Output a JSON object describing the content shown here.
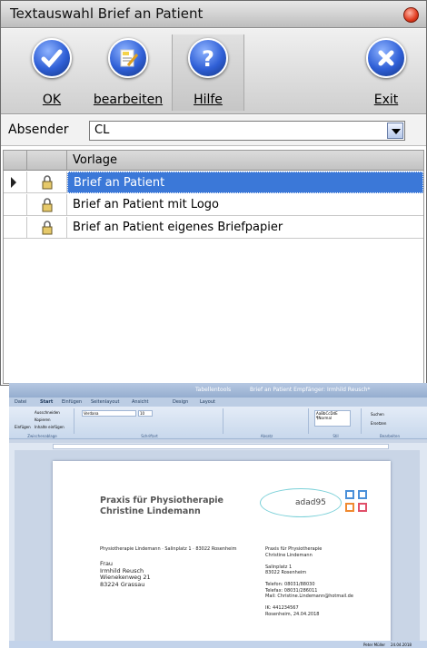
{
  "dialog": {
    "title": "Textauswahl Brief an Patient",
    "toolbar": {
      "ok": "OK",
      "edit": "bearbeiten",
      "help": "Hilfe",
      "exit": "Exit"
    },
    "sender_label": "Absender",
    "sender_value": "CL",
    "grid": {
      "header": "Vorlage",
      "rows": [
        "Brief an Patient",
        "Brief an Patient mit Logo",
        "Brief an Patient eigenes Briefpapier"
      ],
      "selected_index": 0
    }
  },
  "word": {
    "title": "Brief an Patient Empfänger: Irmhild Reusch*",
    "contextual_tab": "Tabellentools",
    "tabs": [
      "Datei",
      "Start",
      "Einfügen",
      "Seitenlayout",
      "Ansicht",
      "Design",
      "Layout"
    ],
    "clipboard": {
      "paste": "Einfügen",
      "cut": "Ausschneiden",
      "copy": "Kopieren",
      "paste_content": "Inhalte einfügen",
      "group": "Zwischenablage"
    },
    "font": {
      "name": "Verdana",
      "size": "10",
      "group": "Schriftart"
    },
    "paragraph_group": "Absatz",
    "styles": {
      "sample": "AaBbCcDdE",
      "name": "¶Normal",
      "group": "Stil"
    },
    "editing": {
      "search": "Suchen",
      "replace": "Ersetzen",
      "group": "Bearbeiten"
    },
    "status": [
      "Peter Müller",
      "24.04.2018"
    ],
    "letter": {
      "praxis_line1": "Praxis für Physiotherapie",
      "praxis_line2": "Christine Lindemann",
      "logo_text": "adad95",
      "sender_small": "Physiotherapie Lindemann · Salinplatz 1 · 83022 Rosenheim",
      "recipient": [
        "Frau",
        "Irmhild Reusch",
        "Wienekenweg 21",
        "83224 Grassau"
      ],
      "right_block": [
        "Praxis für Physiotherapie",
        "Christine Lindemann",
        "",
        "Salinplatz 1",
        "83022 Rosenheim",
        "",
        "Telefon: 08031/88030",
        "Telefax: 08031/286011",
        "Mail: Christine.Lindemann@hotmail.de",
        "",
        "IK: 441234567",
        "Rosenheim, 24.04.2018"
      ]
    }
  },
  "colors": {
    "selection": "#3b78d8",
    "logo_teal": "#7ad0d8",
    "sq_blue": "#4a90d9",
    "sq_orange": "#f08a30",
    "sq_red": "#e0506a",
    "sq_green": "#7ac043"
  }
}
